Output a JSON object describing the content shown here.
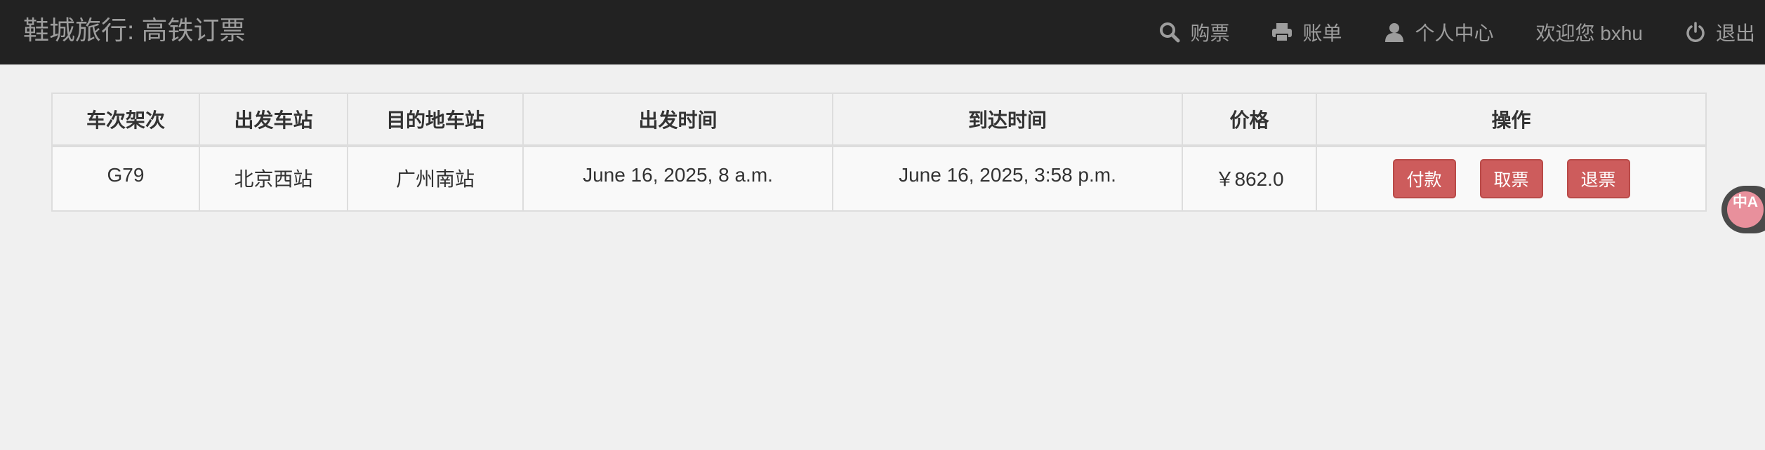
{
  "brand": "鞋城旅行: 高铁订票",
  "nav": {
    "buy_label": "购票",
    "bill_label": "账单",
    "profile_label": "个人中心",
    "welcome_label": "欢迎您 bxhu",
    "logout_label": "退出"
  },
  "table": {
    "headers": [
      "车次架次",
      "出发车站",
      "目的地车站",
      "出发时间",
      "到达时间",
      "价格",
      "操作"
    ],
    "rows": [
      {
        "train": "G79",
        "from": "北京西站",
        "to": "广州南站",
        "depart": "June 16, 2025, 8 a.m.",
        "arrive": "June 16, 2025, 3:58 p.m.",
        "price": "￥862.0",
        "actions": {
          "pay": "付款",
          "cancel": "取票",
          "refund": "退票"
        }
      }
    ]
  },
  "translate_widget": {
    "text": "中A"
  },
  "colors": {
    "navbar_bg": "#222222",
    "danger_button": "#cd5c5c",
    "page_bg": "#f0f0f0"
  }
}
